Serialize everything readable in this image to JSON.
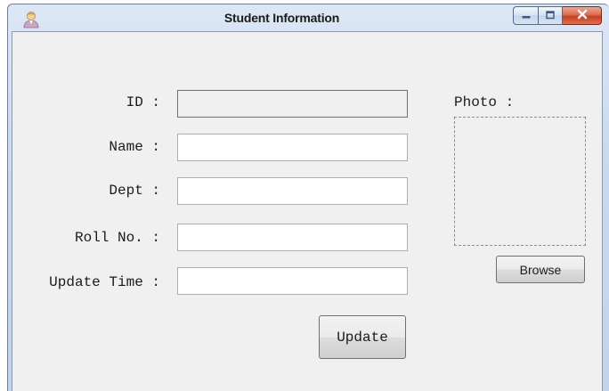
{
  "window": {
    "title": "Student Information"
  },
  "form": {
    "fields": [
      {
        "label": "ID :",
        "value": "",
        "readonly": true
      },
      {
        "label": "Name :",
        "value": ""
      },
      {
        "label": "Dept :",
        "value": ""
      },
      {
        "label": "Roll No. :",
        "value": ""
      },
      {
        "label": "Update Time :",
        "value": ""
      }
    ],
    "update_label": "Update"
  },
  "photo": {
    "label": "Photo :",
    "browse_label": "Browse"
  },
  "icons": {
    "app": "user-icon",
    "minimize": "minimize-icon",
    "maximize": "maximize-icon",
    "close": "close-icon"
  },
  "colors": {
    "titlebar": "#c9d9ee",
    "client_bg": "#f0f0f0",
    "close_button": "#c73f22",
    "focus_border": "#3c7fb1"
  }
}
